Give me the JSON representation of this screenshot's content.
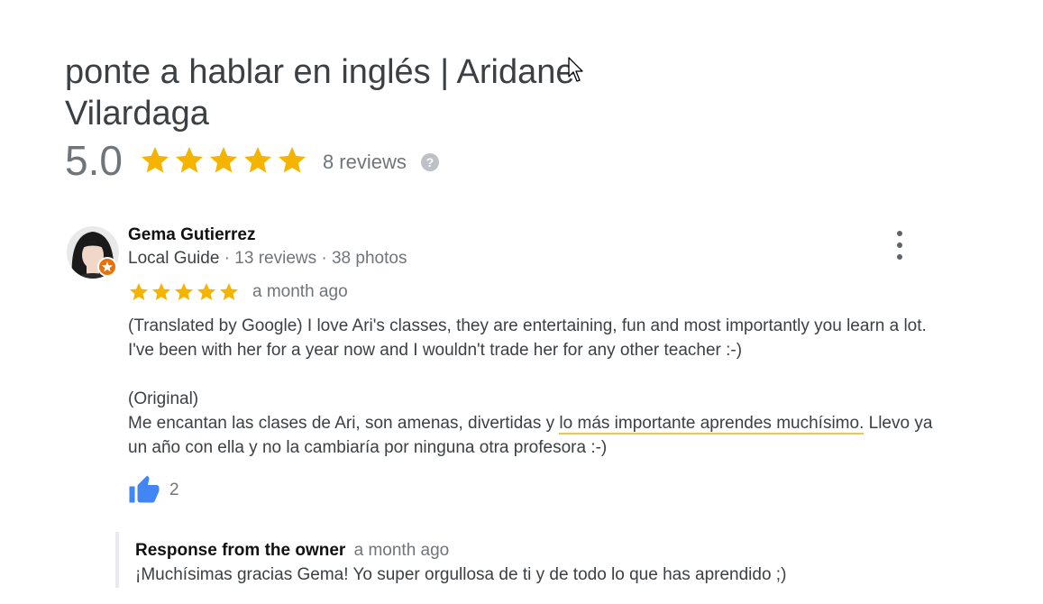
{
  "business": {
    "title": "ponte a hablar en inglés | Aridane Vilardaga"
  },
  "summary": {
    "rating": "5.0",
    "stars": 5,
    "reviews_label": "8 reviews",
    "help_icon": "?"
  },
  "colors": {
    "star": "#f4b400",
    "like": "#4285f4",
    "badge": "#e8710a",
    "highlight": "#f5c542"
  },
  "review": {
    "reviewer_name": "Gema Gutierrez",
    "reviewer_level": "Local Guide",
    "reviewer_stats": " · 13 reviews · 38 photos",
    "stars": 5,
    "date": "a month ago",
    "translated": "(Translated by Google) I love Ari's classes, they are entertaining, fun and most importantly you learn a lot. I've been with her for a year now and I wouldn't trade her for any other teacher :-)",
    "original_label": "(Original)",
    "original_part1": "Me encantan las clases de Ari, son amenas, divertidas y ",
    "original_highlight": "lo más importante aprendes muchísimo.",
    "original_part2": " Llevo ya un año con ella y no la cambiaría por ninguna otra profesora :-)",
    "likes": "2",
    "icons": {
      "avatar": "avatar",
      "local_guide_badge": "local-guide-badge-icon",
      "more": "more-vert-icon",
      "like": "thumbs-up-icon"
    }
  },
  "owner_response": {
    "label": "Response from the owner",
    "date": "a month ago",
    "text": "¡Muchísimas gracias Gema! Yo super orgullosa de ti y de todo lo que has aprendido ;)"
  }
}
